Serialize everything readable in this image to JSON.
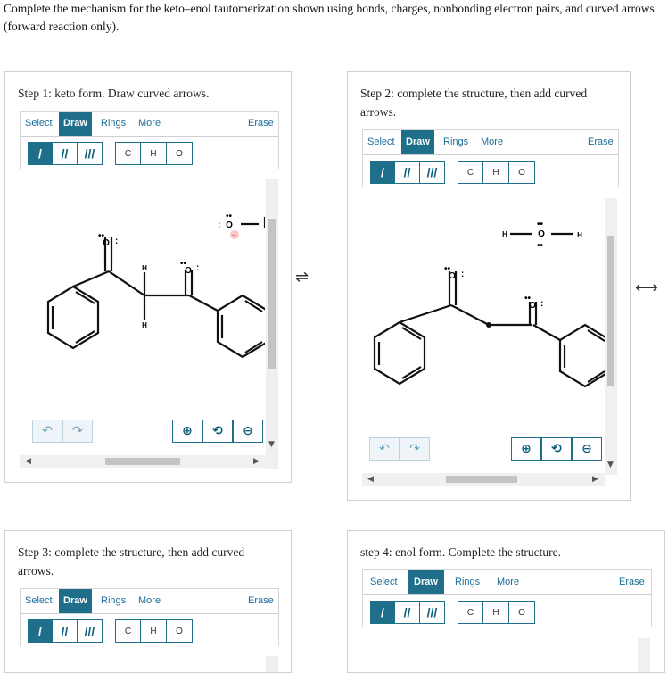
{
  "prompt": "Complete the mechanism for the keto–enol tautomerization shown using bonds, charges, nonbonding electron pairs, and curved arrows (forward reaction only).",
  "toolbar": {
    "select": "Select",
    "draw": "Draw",
    "rings": "Rings",
    "more": "More",
    "erase": "Erase"
  },
  "atom_buttons": [
    "C",
    "H",
    "O"
  ],
  "bond_buttons": [
    "/",
    "//",
    "///"
  ],
  "icons": {
    "undo": "undo-icon",
    "redo": "redo-icon",
    "zoom_in": "zoom-in-icon",
    "zoom_reset": "zoom-reset-icon",
    "zoom_out": "zoom-out-icon",
    "equilibrium": "equilibrium-arrows-icon",
    "resonance": "resonance-arrow-icon"
  },
  "steps": [
    {
      "title": "Step 1: keto form. Draw curved arrows."
    },
    {
      "title": "Step 2: complete the structure, then add curved arrows."
    },
    {
      "title": "Step 3: complete the structure, then add curved arrows."
    },
    {
      "title": "step 4: enol form. Complete the structure."
    }
  ],
  "molecule_labels": {
    "O": "O",
    "H": "H"
  }
}
